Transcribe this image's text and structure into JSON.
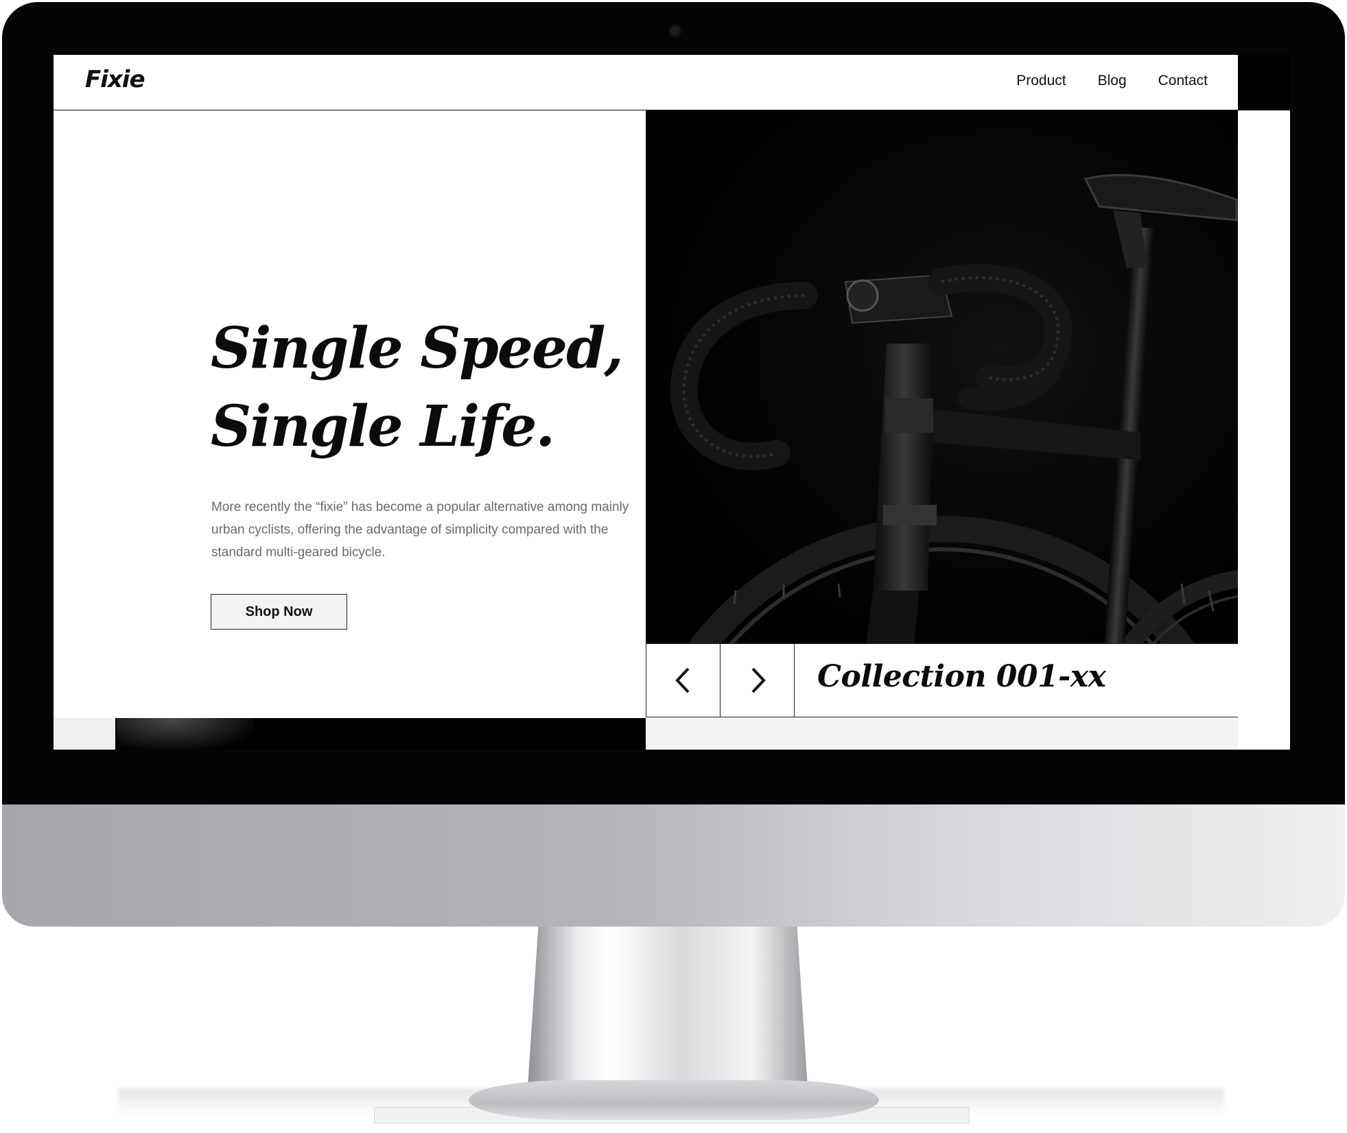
{
  "brand": {
    "logo": "Fixie"
  },
  "nav": {
    "items": [
      "Product",
      "Blog",
      "Contact"
    ]
  },
  "hero": {
    "headline_line1": "Single Speed,",
    "headline_line2": "Single Life.",
    "body": "More recently the “fixie” has become a popular alternative among mainly urban cyclists, offering the advantage of simplicity compared with the standard multi-geared bicycle.",
    "cta_label": "Shop Now"
  },
  "slider": {
    "title": "Collection 001-xx",
    "prev_icon": "chevron-left-icon",
    "next_icon": "chevron-right-icon"
  },
  "colors": {
    "text": "#0b0b0b",
    "muted_text": "#6a6a6a",
    "button_bg": "#f1f3f4",
    "image_bg": "#020202"
  }
}
